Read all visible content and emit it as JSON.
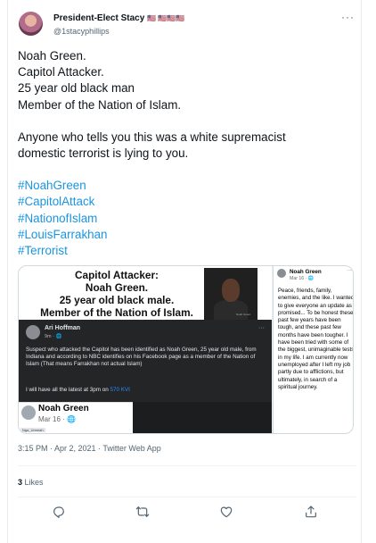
{
  "author": {
    "display_name": "President-Elect Stacy",
    "name_flags": "🇺🇸 🇺🇸🇺🇸🇺🇸",
    "handle": "@1stacyphillips"
  },
  "tweet": {
    "lines": [
      "Noah Green.",
      "Capitol Attacker.",
      "25 year old black man",
      "Member of the Nation of Islam."
    ],
    "paragraph2": [
      "Anyone who tells you this was a white supremacist",
      "domestic terrorist is lying to you."
    ],
    "hashtags": [
      "#NoahGreen",
      "#CapitolAttack",
      "#NationofIslam",
      "#LouisFarrakhan",
      "#Terrorist"
    ]
  },
  "media": {
    "headline": [
      "Capitol Attacker:",
      "Noah Green.",
      "25 year old black male.",
      "Member of the Nation of Islam."
    ],
    "photo_caption": "Noah Green",
    "fb1": {
      "name": "Ari Hoffman",
      "time": "9m · 🌐",
      "more": "···",
      "post": "Suspect who attacked the Capitol has been identified as Noah Green, 25 year old male, from Indiana and according to NBC identifies on his Facebook page as a member of the Nation of Islam (That means Farrakhan not actual Islam)",
      "latest_prefix": "I will have all the latest at 3pm on ",
      "latest_link": "570 KVI"
    },
    "fb2": {
      "name": "Noah Green",
      "time": "Mar 16 · 🌐",
      "tag": "Nga_Ummah"
    },
    "right_post": {
      "name": "Noah Green",
      "time": "Mar 16 · 🌐",
      "more": "···",
      "text": "Peace, friends, family, enemies, and the like. I wanted to give everyone an update as promised... To be honest these past few years have been tough, and these past few months have been tougher. I have been tried with some of the biggest, unimaginable tests in my life. I am currently now unemployed after I left my job partly due to afflictions, but ultimately, in search of a spiritual journey."
    }
  },
  "timestamp": "3:15 PM · Apr 2, 2021 · Twitter Web App",
  "likes": {
    "count": "3",
    "label": "Likes"
  },
  "more_label": "···",
  "actions": [
    "reply-icon",
    "retweet-icon",
    "like-icon",
    "share-icon"
  ],
  "colors": {
    "link": "#1b95e0",
    "secondary": "#536471",
    "divider": "#eff3f4"
  }
}
